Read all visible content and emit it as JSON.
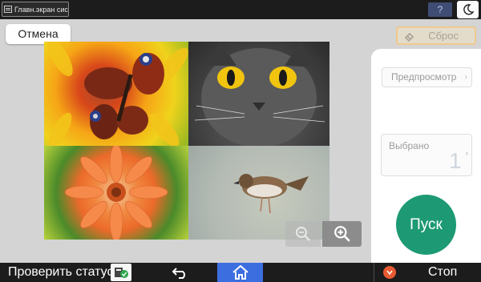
{
  "topbar": {
    "home_screen_label": "Главн.экран сист.",
    "help_label": "?"
  },
  "toolbar": {
    "cancel_label": "Отмена",
    "reset_label": "Сброс"
  },
  "side_panel": {
    "preview_label": "Предпросмотр",
    "selected_label": "Выбрано",
    "selected_count": "1",
    "start_label": "Пуск"
  },
  "bottombar": {
    "status_label": "Проверить статус",
    "stop_label": "Стоп"
  },
  "colors": {
    "start": "#1d9a73",
    "home": "#3d6ee0",
    "stop": "#e85a32",
    "help": "#3f4d74"
  },
  "icons": [
    "moon-icon",
    "eraser-icon",
    "zoom-out-icon",
    "zoom-in-icon",
    "status-check-icon",
    "back-arrow-icon",
    "home-icon",
    "stop-icon",
    "chevron-right-icon"
  ]
}
